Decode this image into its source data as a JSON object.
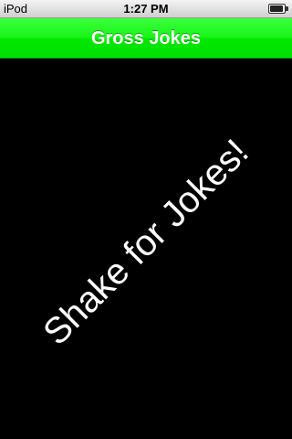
{
  "status_bar": {
    "carrier": "iPod",
    "time": "1:27 PM",
    "battery_icon": "battery-icon",
    "battery_level": 0.95
  },
  "nav_bar": {
    "title": "Gross Jokes",
    "color": "#22f522"
  },
  "main": {
    "prompt": "Shake for Jokes!",
    "background": "#000000",
    "text_color": "#ffffff"
  }
}
